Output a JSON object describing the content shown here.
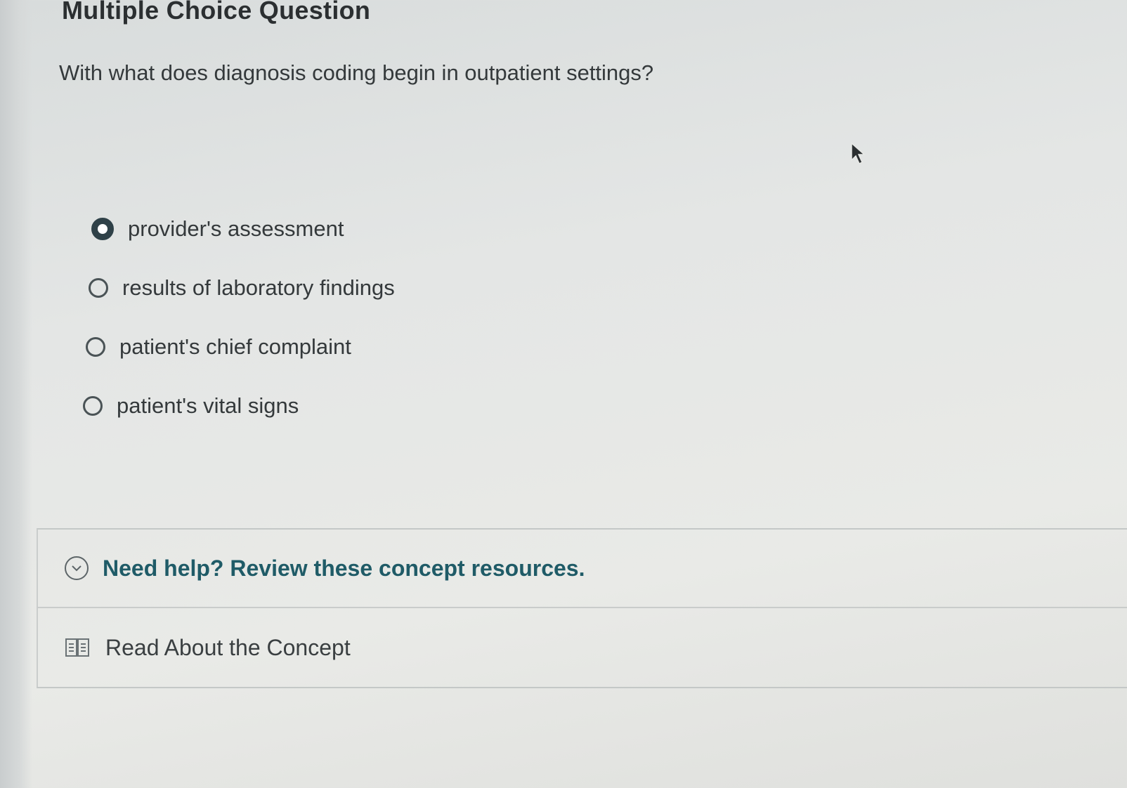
{
  "page": {
    "heading": "Multiple Choice Question",
    "question": "With what does diagnosis coding begin in outpatient settings?"
  },
  "options": [
    {
      "label": "provider's assessment",
      "selected": true
    },
    {
      "label": "results of laboratory findings",
      "selected": false
    },
    {
      "label": "patient's chief complaint",
      "selected": false
    },
    {
      "label": "patient's vital signs",
      "selected": false
    }
  ],
  "help": {
    "title": "Need help? Review these concept resources.",
    "resource_label": "Read About the Concept"
  },
  "colors": {
    "accent": "#1f5b67",
    "selected_radio": "#2f4148",
    "text": "#34393b"
  },
  "icons": {
    "expand": "chevron-down-icon",
    "resource": "book-icon",
    "pointer": "mouse-cursor-icon"
  }
}
